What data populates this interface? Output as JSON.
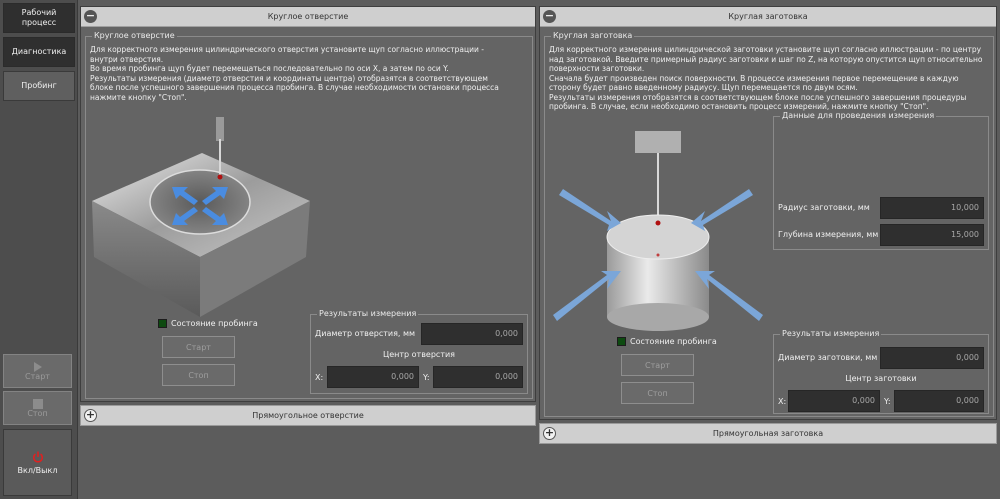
{
  "sidebar": {
    "workflow_label": "Рабочий процесс",
    "diagnostics_label": "Диагностика",
    "probing_label": "Пробинг",
    "start_label": "Старт",
    "stop_label": "Стоп",
    "power_label": "Вкл/Выкл"
  },
  "left_panel": {
    "title": "Круглое отверстие",
    "group_title": "Круглое отверстие",
    "description": [
      "Для корректного измерения цилиндрического отверстия установите щуп согласно иллюстрации - внутри отверстия.",
      "Во время пробинга щуп будет перемещаться последовательно по оси X, а затем по оси Y.",
      "Результаты измерения (диаметр отверстия и координаты центра) отобразятся в соответствующем блоке после успешного завершения процесса пробинга. В случае необходимости остановки процесса нажмите кнопку \"Стоп\"."
    ],
    "probe_state_label": "Состояние пробинга",
    "start_label": "Старт",
    "stop_label": "Стоп",
    "results_title": "Результаты измерения",
    "diameter_label": "Диаметр отверстия, мм",
    "diameter_value": "0,000",
    "center_label": "Центр отверстия",
    "x_label": "X:",
    "x_value": "0,000",
    "y_label": "Y:",
    "y_value": "0,000"
  },
  "left_collapsed": {
    "title": "Прямоугольное отверстие"
  },
  "right_panel": {
    "title": "Круглая заготовка",
    "group_title": "Круглая заготовка",
    "description": [
      "Для корректного измерения цилиндрической заготовки установите щуп согласно иллюстрации - по центру над заготовкой. Введите примерный радиус заготовки и шаг по Z, на которую опустится щуп относительно поверхности заготовки.",
      "Сначала будет произведен поиск поверхности. В процессе измерения первое перемещение в каждую сторону будет равно введенному радиусу. Щуп перемещается по двум осям.",
      "Результаты измерения отобразятся в соответствующем блоке после успешного завершения процедуры пробинга. В случае, если необходимо остановить процесс измерений, нажмите кнопку \"Стоп\"."
    ],
    "input_title": "Данные для проведения измерения",
    "radius_label": "Радиус заготовки, мм",
    "radius_value": "10,000",
    "depth_label": "Глубина измерения, мм",
    "depth_value": "15,000",
    "probe_state_label": "Состояние пробинга",
    "start_label": "Старт",
    "stop_label": "Стоп",
    "results_title": "Результаты измерения",
    "diameter_label": "Диаметр заготовки, мм",
    "diameter_value": "0,000",
    "center_label": "Центр заготовки",
    "x_label": "X:",
    "x_value": "0,000",
    "y_label": "Y:",
    "y_value": "0,000"
  },
  "right_collapsed": {
    "title": "Прямоугольная заготовка"
  },
  "colors": {
    "led": "#0d4a10",
    "arrow": "#3a7fd0",
    "power_icon": "#e02020"
  }
}
